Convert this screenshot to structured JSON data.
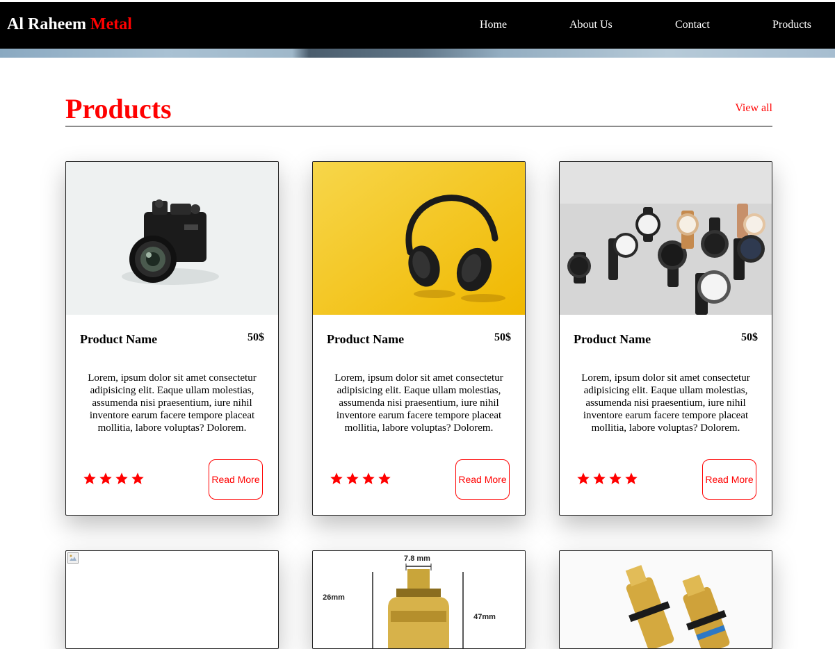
{
  "brand": {
    "part1": "Al Raheem",
    "part2": "Metal"
  },
  "nav": {
    "links": [
      {
        "label": "Home"
      },
      {
        "label": "About Us"
      },
      {
        "label": "Contact"
      },
      {
        "label": "Products"
      }
    ]
  },
  "section": {
    "title": "Products",
    "view_all": "View all"
  },
  "products": [
    {
      "image": "camera",
      "name": "Product Name",
      "price": "50$",
      "description": "Lorem, ipsum dolor sit amet consectetur adipisicing elit. Eaque ullam molestias, assumenda nisi praesentium, iure nihil inventore earum facere tempore placeat mollitia, labore voluptas? Dolorem.",
      "rating": 4,
      "button": "Read More"
    },
    {
      "image": "headphones",
      "name": "Product Name",
      "price": "50$",
      "description": "Lorem, ipsum dolor sit amet consectetur adipisicing elit. Eaque ullam molestias, assumenda nisi praesentium, iure nihil inventore earum facere tempore placeat mollitia, labore voluptas? Dolorem.",
      "rating": 4,
      "button": "Read More"
    },
    {
      "image": "watches",
      "name": "Product Name",
      "price": "50$",
      "description": "Lorem, ipsum dolor sit amet consectetur adipisicing elit. Eaque ullam molestias, assumenda nisi praesentium, iure nihil inventore earum facere tempore placeat mollitia, labore voluptas? Dolorem.",
      "rating": 4,
      "button": "Read More"
    }
  ],
  "products_row2": [
    {
      "image": "broken-image"
    },
    {
      "image": "brass-cartridge-dimensions",
      "dims": [
        "7.8 mm",
        "26mm",
        "47mm"
      ]
    },
    {
      "image": "brass-cartridges"
    }
  ],
  "colors": {
    "accent": "#ff0000",
    "navbar": "#000000",
    "text": "#000000",
    "background": "#ffffff"
  }
}
